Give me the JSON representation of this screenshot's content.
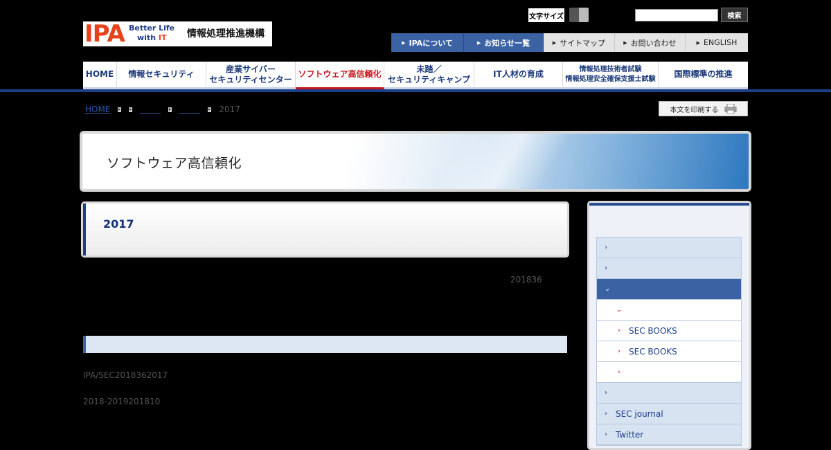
{
  "header": {
    "logo": {
      "mark": "IPA",
      "tagline_line1": "Better Life",
      "tagline_line2_prefix": "with ",
      "tagline_line2_it": "IT",
      "org_name": "情報処理推進機構"
    },
    "font_size_label": "文字サイズ",
    "search": {
      "value": "",
      "button_label": "検索"
    },
    "util_nav": [
      {
        "label": "IPAについて",
        "style": "dark"
      },
      {
        "label": "お知らせ一覧",
        "style": "dark"
      },
      {
        "label": "サイトマップ",
        "style": "light"
      },
      {
        "label": "お問い合わせ",
        "style": "light"
      },
      {
        "label": "ENGLISH",
        "style": "light"
      }
    ]
  },
  "global_nav": [
    {
      "label": "HOME"
    },
    {
      "label": "情報セキュリティ"
    },
    {
      "line1": "産業サイバー",
      "line2": "セキュリティセンター"
    },
    {
      "label": "ソフトウェア高信頼化",
      "active": true
    },
    {
      "line1": "未踏／",
      "line2": "セキュリティキャンプ"
    },
    {
      "label": "IT人材の育成"
    },
    {
      "line1": "情報処理技術者試験",
      "line2": "情報処理安全確保支援士試験",
      "small": true
    },
    {
      "label": "国際標準の推進"
    }
  ],
  "breadcrumb": {
    "home": "HOME",
    "current": "2017"
  },
  "print_label": "本文を印刷する",
  "hero": {
    "title": "ソフトウェア高信頼化"
  },
  "main": {
    "page_title": "2017",
    "date": "201836",
    "para1": "IPA/SEC2018362017",
    "para2": "2018-2019201810"
  },
  "sidebar": {
    "items": [
      {
        "label": "",
        "type": "normal"
      },
      {
        "label": "",
        "type": "normal"
      },
      {
        "label": "",
        "type": "active"
      },
      {
        "label": "",
        "type": "sub-open"
      },
      {
        "label": "SEC BOOKS",
        "type": "sub"
      },
      {
        "label": "SEC BOOKS",
        "type": "sub"
      },
      {
        "label": "",
        "type": "sub"
      },
      {
        "label": "",
        "type": "normal"
      },
      {
        "label": "SEC journal",
        "type": "normal"
      },
      {
        "label": "Twitter",
        "type": "normal"
      }
    ]
  },
  "colors": {
    "brand_blue": "#1d3f88",
    "accent_red": "#c8161d",
    "logo_orange": "#e6421c"
  }
}
